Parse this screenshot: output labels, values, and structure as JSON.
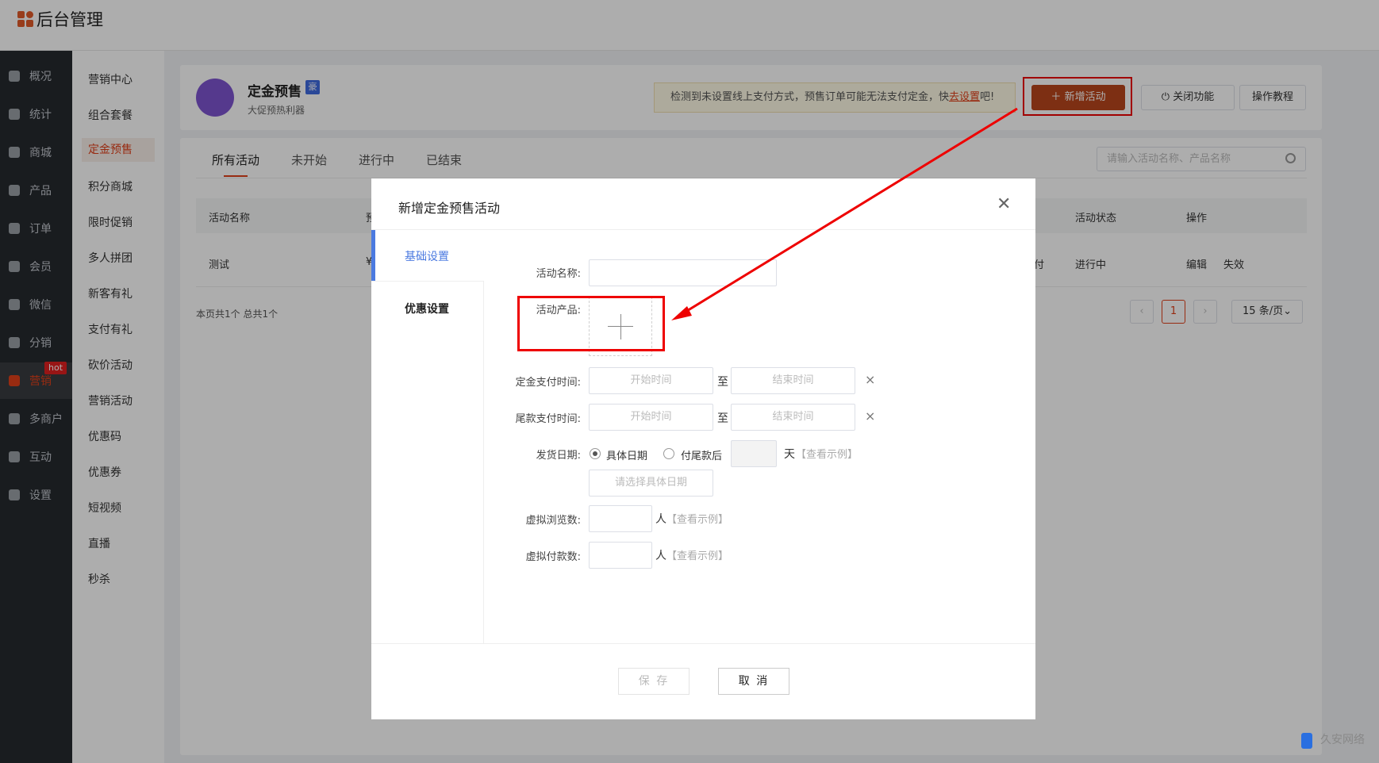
{
  "app": {
    "title": "后台管理"
  },
  "sidebar": {
    "items": [
      {
        "label": "概况"
      },
      {
        "label": "统计"
      },
      {
        "label": "商城"
      },
      {
        "label": "产品"
      },
      {
        "label": "订单"
      },
      {
        "label": "会员"
      },
      {
        "label": "微信"
      },
      {
        "label": "分销"
      },
      {
        "label": "营销",
        "active": true
      },
      {
        "label": "多商户"
      },
      {
        "label": "互动"
      },
      {
        "label": "设置"
      }
    ],
    "hot_badge": "hot"
  },
  "subnav": {
    "items": [
      "营销中心",
      "组合套餐",
      "定金预售",
      "积分商城",
      "限时促销",
      "多人拼团",
      "新客有礼",
      "支付有礼",
      "砍价活动",
      "营销活动",
      "优惠码",
      "优惠券",
      "短视频",
      "直播",
      "秒杀"
    ],
    "active": "定金预售"
  },
  "header": {
    "title": "定金预售",
    "tag": "豪",
    "subtitle": "大促预热利器",
    "warning_prefix": "检测到未设置线上支付方式，预售订单可能无法支付定金，快",
    "warning_link": "去设置",
    "warning_suffix": "吧!",
    "add_button": "新增活动",
    "close_button": "关闭功能",
    "tutorial_button": "操作教程"
  },
  "tabs": [
    "所有活动",
    "未开始",
    "进行中",
    "已结束"
  ],
  "search": {
    "placeholder": "请输入活动名称、产品名称"
  },
  "table": {
    "columns": [
      "活动名称",
      "活动状态",
      "操作"
    ],
    "row": {
      "name": "测试",
      "status": "进行中",
      "partial": "付",
      "edit": "编辑",
      "invalid": "失效"
    },
    "partial_col": "预",
    "partial_cell": "¥"
  },
  "pagination": {
    "summary": "本页共1个 总共1个",
    "current": "1",
    "page_size": "15 条/页"
  },
  "modal": {
    "title": "新增定金预售活动",
    "tabs": {
      "basic": "基础设置",
      "discount": "优惠设置"
    },
    "fields": {
      "name": "活动名称:",
      "product": "活动产品:",
      "deposit_time": "定金支付时间:",
      "final_time": "尾款支付时间:",
      "ship_date": "发货日期:",
      "views": "虚拟浏览数:",
      "payers": "虚拟付款数:"
    },
    "start_placeholder": "开始时间",
    "end_placeholder": "结束时间",
    "to": "至",
    "clear": "×",
    "ship_options": [
      "具体日期",
      "付尾款后"
    ],
    "day_unit": "天",
    "see_example": "【查看示例】",
    "date_placeholder": "请选择具体日期",
    "person_unit": "人",
    "save": "保 存",
    "cancel": "取 消"
  },
  "watermark": "久安网络"
}
